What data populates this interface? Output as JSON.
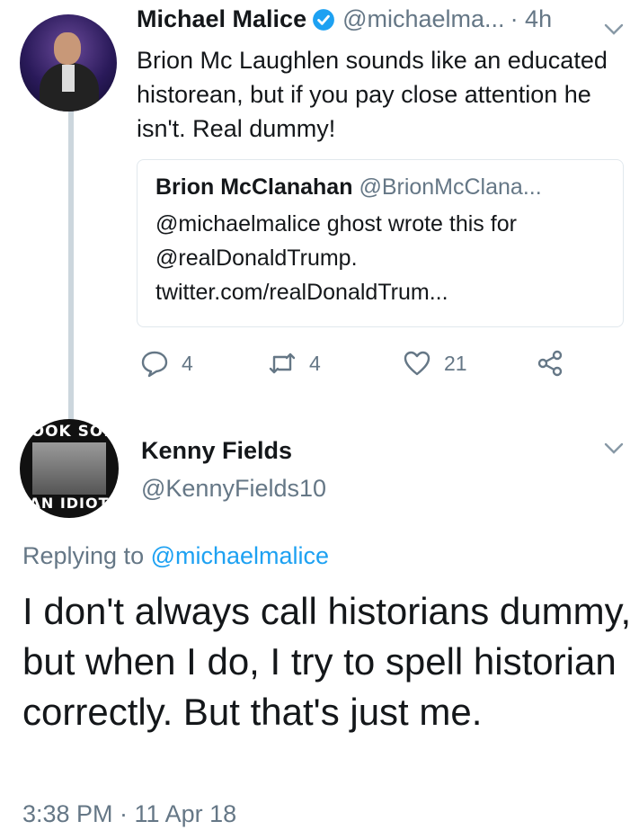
{
  "tweet1": {
    "name": "Michael Malice",
    "handle": "@michaelma...",
    "time": "· 4h",
    "text": "Brion Mc Laughlen sounds like an educated historean, but if you pay close attention he isn't. Real dummy!",
    "quote": {
      "name": "Brion McClanahan",
      "handle": "@BrionMcClana...",
      "text": "@michaelmalice ghost wrote this for @realDonaldTrump. twitter.com/realDonaldTrum..."
    },
    "actions": {
      "reply_count": "4",
      "retweet_count": "4",
      "like_count": "21"
    }
  },
  "tweet2": {
    "avatar_text_top": "LOOK SON",
    "avatar_text_bottom": "AN IDIOT",
    "name": "Kenny Fields",
    "handle": "@KennyFields10",
    "replying_prefix": "Replying to",
    "replying_handle": "@michaelmalice",
    "text": "I don't always call historians dummy, but when I do, I try to spell historian correctly.  But that's just me.",
    "timestamp": "3:38 PM · 11 Apr 18"
  },
  "colors": {
    "link": "#1da1f2",
    "verified": "#1da1f2",
    "muted": "#657786",
    "thread_line": "#ccd6dd",
    "border": "#e1e8ed"
  },
  "icons": [
    "verified-badge-icon",
    "chevron-down-icon",
    "reply-icon",
    "retweet-icon",
    "like-icon",
    "share-icon"
  ]
}
